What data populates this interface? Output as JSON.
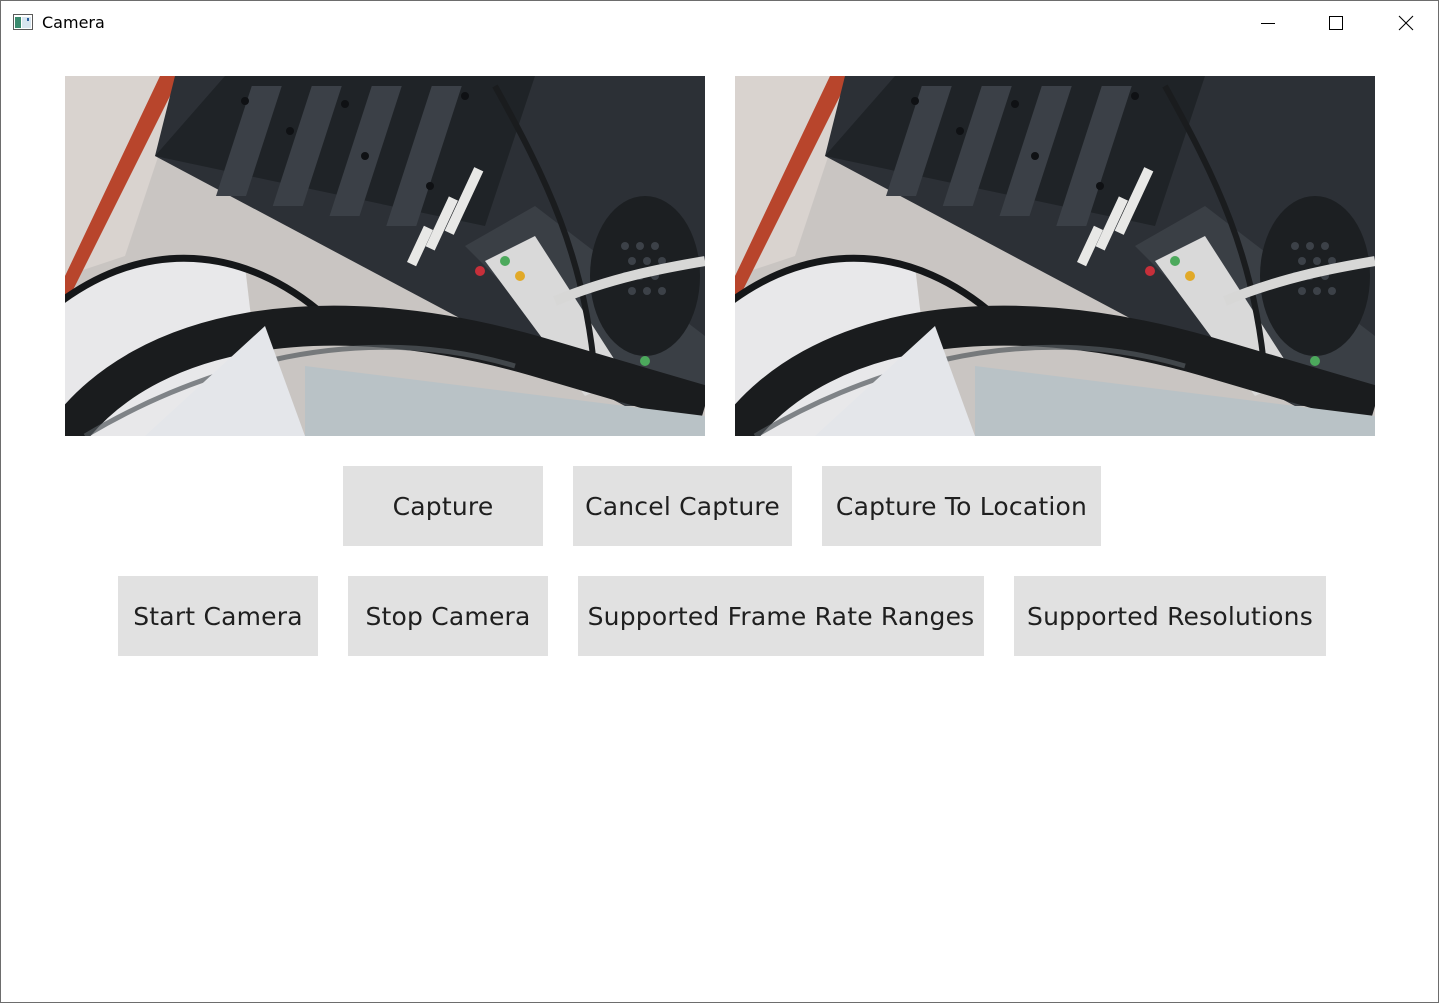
{
  "window": {
    "title": "Camera",
    "icon": "camera-app-icon"
  },
  "caption_buttons": {
    "minimize_icon": "minimize-icon",
    "maximize_icon": "maximize-icon",
    "close_icon": "close-icon"
  },
  "previews": [
    {
      "name": "camera-preview-left",
      "content": "live camera feed"
    },
    {
      "name": "camera-preview-right",
      "content": "live camera feed"
    }
  ],
  "buttons": {
    "capture": "Capture",
    "cancel_capture": "Cancel Capture",
    "capture_to_location": "Capture To Location",
    "start_camera": "Start Camera",
    "stop_camera": "Stop Camera",
    "supported_frame_rate_ranges": "Supported Frame Rate Ranges",
    "supported_resolutions": "Supported Resolutions"
  },
  "colors": {
    "button_bg": "#e1e1e1",
    "button_text": "#1f1f1f",
    "window_bg": "#ffffff"
  }
}
